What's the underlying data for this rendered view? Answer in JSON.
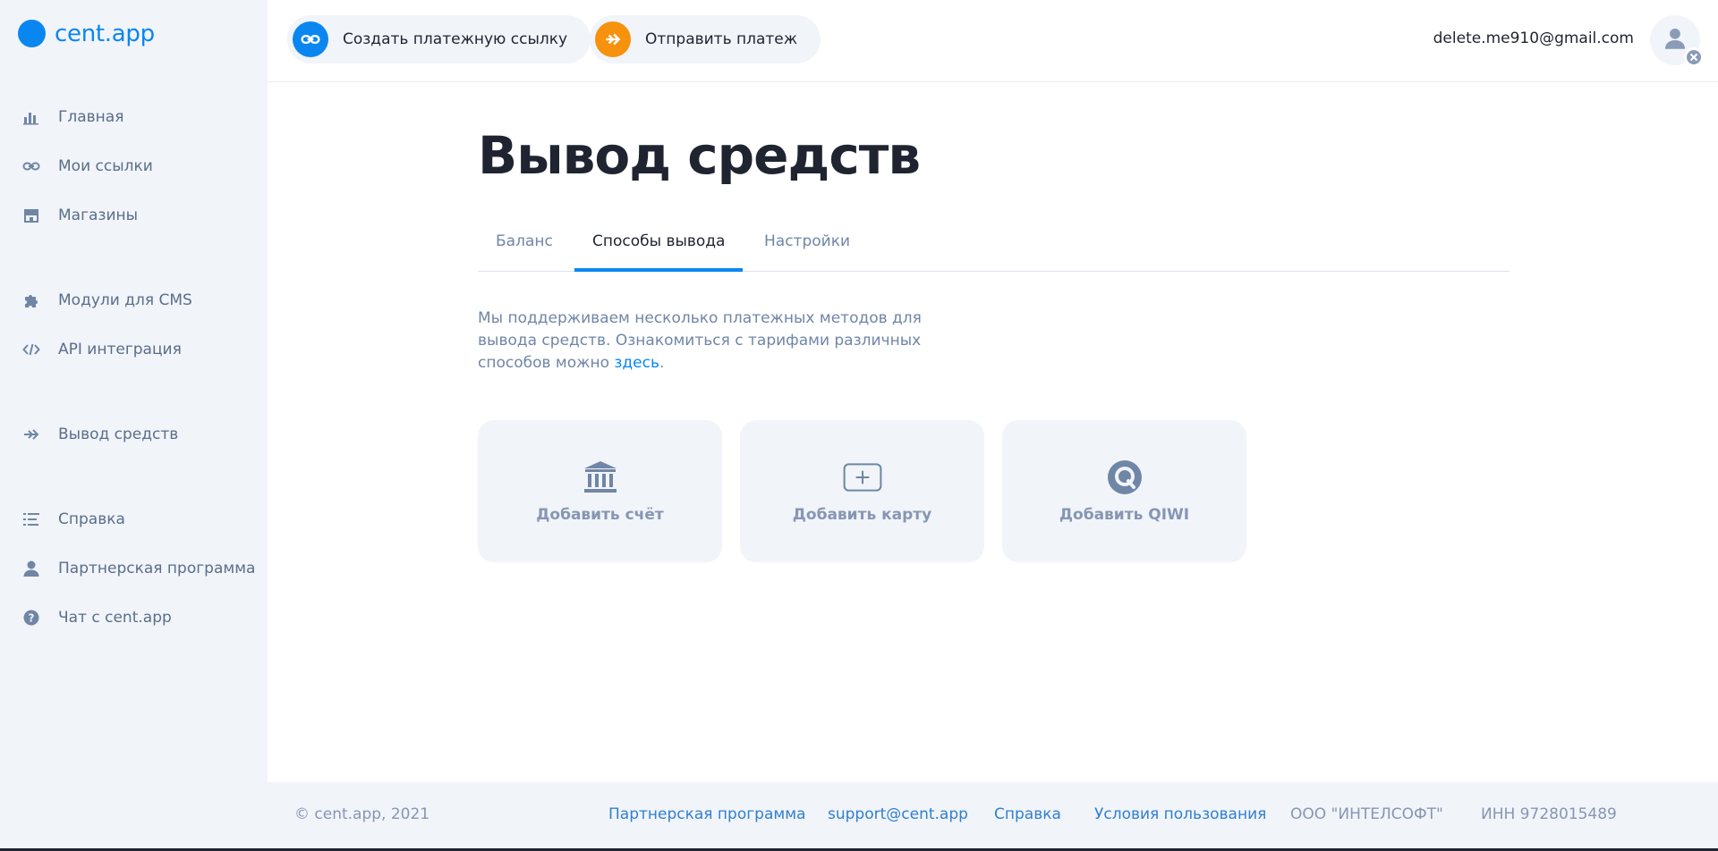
{
  "brand": {
    "name_main": "cent",
    "name_suffix": ".app",
    "color": "#0a86f0"
  },
  "sidebar": {
    "items": [
      {
        "label": "Главная",
        "icon": "bar-chart-icon"
      },
      {
        "label": "Мои ссылки",
        "icon": "link-icon"
      },
      {
        "label": "Магазины",
        "icon": "store-icon"
      },
      {
        "label": "Модули для CMS",
        "icon": "puzzle-icon"
      },
      {
        "label": "API интеграция",
        "icon": "code-icon"
      },
      {
        "label": "Вывод средств",
        "icon": "double-arrow-icon"
      },
      {
        "label": "Справка",
        "icon": "list-icon"
      },
      {
        "label": "Партнерская программа",
        "icon": "user-icon"
      },
      {
        "label": "Чат с cent.app",
        "icon": "help-icon"
      }
    ]
  },
  "header": {
    "create_link_label": "Создать платежную ссылку",
    "send_payment_label": "Отправить платеж",
    "user_email": "delete.me910@gmail.com"
  },
  "main": {
    "title": "Вывод средств",
    "tabs": [
      {
        "label": "Баланс",
        "active": false
      },
      {
        "label": "Способы вывода",
        "active": true
      },
      {
        "label": "Настройки",
        "active": false
      }
    ],
    "description": "Мы поддерживаем несколько платежных методов для вывода средств. Ознакомиться с тарифами различных способов можно",
    "description_link": "здесь",
    "description_end": ".",
    "cards": [
      {
        "label": "Добавить счёт",
        "icon": "bank-icon"
      },
      {
        "label": "Добавить карту",
        "icon": "card-plus-icon"
      },
      {
        "label": "Добавить QIWI",
        "icon": "qiwi-icon"
      }
    ]
  },
  "footer": {
    "copyright": "© cent.app, 2021",
    "partner_program": "Партнерская программа",
    "support_email": "support@cent.app",
    "help": "Справка",
    "terms": "Условия пользования",
    "company": "ООО \"ИНТЕЛСОФТ\"",
    "inn": "ИНН 9728015489"
  },
  "colors": {
    "accent": "#0a86f0",
    "orange": "#f7920e",
    "muted": "#7086a6",
    "panel": "#f1f4f9"
  }
}
